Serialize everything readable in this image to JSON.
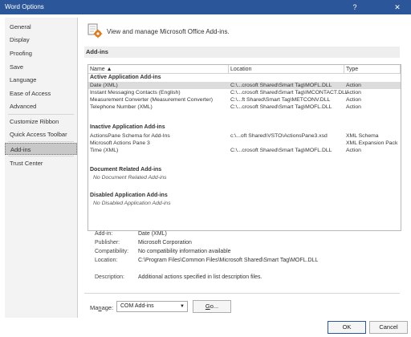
{
  "window": {
    "title": "Word Options",
    "help": "?",
    "close": "✕"
  },
  "sidebar": {
    "items": [
      {
        "label": "General"
      },
      {
        "label": "Display"
      },
      {
        "label": "Proofing"
      },
      {
        "label": "Save"
      },
      {
        "label": "Language"
      },
      {
        "label": "Ease of Access"
      },
      {
        "label": "Advanced"
      },
      {
        "label": "Customize Ribbon"
      },
      {
        "label": "Quick Access Toolbar"
      },
      {
        "label": "Add-ins"
      },
      {
        "label": "Trust Center"
      }
    ]
  },
  "header": {
    "text": "View and manage Microsoft Office Add-ins."
  },
  "section": {
    "label": "Add-ins"
  },
  "table": {
    "columns": {
      "name": "Name ▲",
      "location": "Location",
      "type": "Type"
    },
    "groups": {
      "active": "Active Application Add-ins",
      "inactive": "Inactive Application Add-ins",
      "document": "Document Related Add-ins",
      "disabled": "Disabled Application Add-ins"
    },
    "active_rows": [
      {
        "name": "Date (XML)",
        "location": "C:\\...crosoft Shared\\Smart Tag\\MOFL.DLL",
        "type": "Action"
      },
      {
        "name": "Instant Messaging Contacts (English)",
        "location": "C:\\...crosoft Shared\\Smart Tag\\IMCONTACT.DLL",
        "type": "Action"
      },
      {
        "name": "Measurement Converter (Measurement Converter)",
        "location": "C:\\...ft Shared\\Smart Tag\\METCONV.DLL",
        "type": "Action"
      },
      {
        "name": "Telephone Number (XML)",
        "location": "C:\\...crosoft Shared\\Smart Tag\\MOFL.DLL",
        "type": "Action"
      }
    ],
    "inactive_rows": [
      {
        "name": "ActionsPane Schema for Add-Ins",
        "location": "c:\\...oft Shared\\VSTO\\ActionsPane3.xsd",
        "type": "XML Schema"
      },
      {
        "name": "Microsoft Actions Pane 3",
        "location": "",
        "type": "XML Expansion Pack"
      },
      {
        "name": "Time (XML)",
        "location": "C:\\...crosoft Shared\\Smart Tag\\MOFL.DLL",
        "type": "Action"
      }
    ],
    "document_empty": "No Document Related Add-ins",
    "disabled_empty": "No Disabled Application Add-ins"
  },
  "details": {
    "addin_label": "Add-in:",
    "addin_value": "Date (XML)",
    "publisher_label": "Publisher:",
    "publisher_value": "Microsoft Corporation",
    "compat_label": "Compatibility:",
    "compat_value": "No compatibility information available",
    "location_label": "Location:",
    "location_value": "C:\\Program Files\\Common Files\\Microsoft Shared\\Smart Tag\\MOFL.DLL",
    "desc_label": "Description:",
    "desc_value": "Additional actions specified in list description files."
  },
  "manage": {
    "label_pre": "Ma",
    "label_underline": "n",
    "label_post": "age:",
    "selected": "COM Add-ins",
    "go_pre": "",
    "go_underline": "G",
    "go_post": "o..."
  },
  "footer": {
    "ok": "OK",
    "cancel": "Cancel"
  },
  "colors": {
    "titlebar": "#2b579a",
    "selection": "#dcdcdc"
  }
}
